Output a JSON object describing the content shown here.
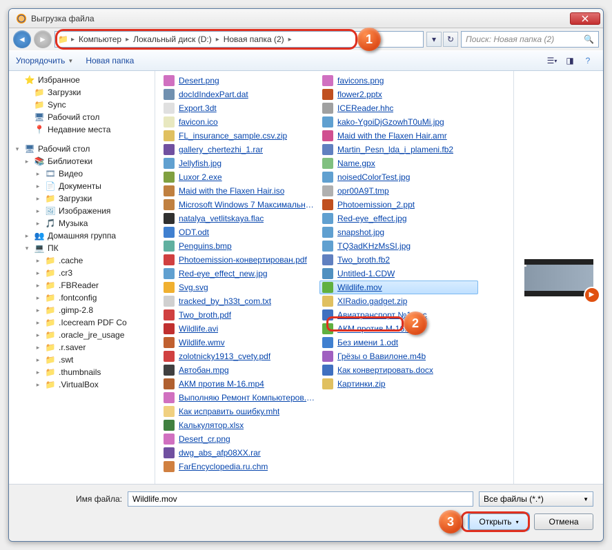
{
  "window": {
    "title": "Выгрузка файла"
  },
  "nav": {
    "crumbs": [
      "Компьютер",
      "Локальный диск (D:)",
      "Новая папка (2)"
    ],
    "search_placeholder": "Поиск: Новая папка (2)"
  },
  "toolbar": {
    "organize": "Упорядочить",
    "new_folder": "Новая папка"
  },
  "tree": [
    {
      "l": 1,
      "exp": "",
      "ic": "⭐",
      "t": "Избранное",
      "c": "#c8a030"
    },
    {
      "l": 2,
      "exp": "",
      "ic": "📁",
      "t": "Загрузки",
      "c": "#e0b050"
    },
    {
      "l": 2,
      "exp": "",
      "ic": "📁",
      "t": "Sync",
      "c": "#e0b050"
    },
    {
      "l": 2,
      "exp": "",
      "ic": "🖥",
      "t": "Рабочий стол",
      "c": "#4070a0"
    },
    {
      "l": 2,
      "exp": "",
      "ic": "📍",
      "t": "Недавние места",
      "c": "#8090a0"
    },
    {
      "l": 0,
      "gap": true
    },
    {
      "l": 1,
      "exp": "▾",
      "ic": "🖥",
      "t": "Рабочий стол",
      "c": "#4070a0"
    },
    {
      "l": 2,
      "exp": "▸",
      "ic": "📚",
      "t": "Библиотеки",
      "c": "#d0a040"
    },
    {
      "l": 3,
      "exp": "▸",
      "ic": "🎞",
      "t": "Видео",
      "c": "#6080a0"
    },
    {
      "l": 3,
      "exp": "▸",
      "ic": "📄",
      "t": "Документы",
      "c": "#8090a0"
    },
    {
      "l": 3,
      "exp": "▸",
      "ic": "📁",
      "t": "Загрузки",
      "c": "#e0b050"
    },
    {
      "l": 3,
      "exp": "▸",
      "ic": "🖼",
      "t": "Изображения",
      "c": "#60a0c0"
    },
    {
      "l": 3,
      "exp": "▸",
      "ic": "🎵",
      "t": "Музыка",
      "c": "#4080c0"
    },
    {
      "l": 2,
      "exp": "▸",
      "ic": "👥",
      "t": "Домашняя группа",
      "c": "#80a060"
    },
    {
      "l": 2,
      "exp": "▾",
      "ic": "💻",
      "t": "ПК",
      "c": "#6080a0"
    },
    {
      "l": 3,
      "exp": "▸",
      "ic": "📁",
      "t": ".cache",
      "c": "#e0b050"
    },
    {
      "l": 3,
      "exp": "▸",
      "ic": "📁",
      "t": ".cr3",
      "c": "#e0b050"
    },
    {
      "l": 3,
      "exp": "▸",
      "ic": "📁",
      "t": ".FBReader",
      "c": "#e0b050"
    },
    {
      "l": 3,
      "exp": "▸",
      "ic": "📁",
      "t": ".fontconfig",
      "c": "#e0b050"
    },
    {
      "l": 3,
      "exp": "▸",
      "ic": "📁",
      "t": ".gimp-2.8",
      "c": "#e0b050"
    },
    {
      "l": 3,
      "exp": "▸",
      "ic": "📁",
      "t": ".Icecream PDF Co",
      "c": "#e0b050"
    },
    {
      "l": 3,
      "exp": "▸",
      "ic": "📁",
      "t": ".oracle_jre_usage",
      "c": "#e0b050"
    },
    {
      "l": 3,
      "exp": "▸",
      "ic": "📁",
      "t": ".r.saver",
      "c": "#e0b050"
    },
    {
      "l": 3,
      "exp": "▸",
      "ic": "📁",
      "t": ".swt",
      "c": "#e0b050"
    },
    {
      "l": 3,
      "exp": "▸",
      "ic": "📁",
      "t": ".thumbnails",
      "c": "#e0b050"
    },
    {
      "l": 3,
      "exp": "▸",
      "ic": "📁",
      "t": ".VirtualBox",
      "c": "#e0b050"
    }
  ],
  "files_col1": [
    {
      "n": "Desert.png",
      "c": "c-png"
    },
    {
      "n": "docIdIndexPart.dat",
      "c": "c-dat"
    },
    {
      "n": "Export.3dt",
      "c": "c-3dt"
    },
    {
      "n": "favicon.ico",
      "c": "c-ico"
    },
    {
      "n": "FL_insurance_sample.csv.zip",
      "c": "c-zip"
    },
    {
      "n": "gallery_chertezhi_1.rar",
      "c": "c-rar"
    },
    {
      "n": "Jellyfish.jpg",
      "c": "c-jpg"
    },
    {
      "n": "Luxor 2.exe",
      "c": "c-exe"
    },
    {
      "n": "Maid with the Flaxen Hair.iso",
      "c": "c-iso"
    },
    {
      "n": "Microsoft Windows 7 Максимальна...",
      "c": "c-iso"
    },
    {
      "n": "natalya_vetlitskaya.flac",
      "c": "c-flac"
    },
    {
      "n": "ODT.odt",
      "c": "c-odt"
    },
    {
      "n": "Penguins.bmp",
      "c": "c-bmp"
    },
    {
      "n": "Photoemission-конвертирован.pdf",
      "c": "c-pdf"
    },
    {
      "n": "Red-eye_effect_new.jpg",
      "c": "c-jpg"
    },
    {
      "n": "Svg.svg",
      "c": "c-svg"
    },
    {
      "n": "tracked_by_h33t_com.txt",
      "c": "c-txt"
    },
    {
      "n": "Two_broth.pdf",
      "c": "c-pdf"
    },
    {
      "n": "Wildlife.avi",
      "c": "c-avi"
    },
    {
      "n": "Wildlife.wmv",
      "c": "c-wmv"
    },
    {
      "n": "zolotnicky1913_cvety.pdf",
      "c": "c-pdf"
    },
    {
      "n": "Автобан.mpg",
      "c": "c-mpg"
    },
    {
      "n": "АКМ против М-16.mp4",
      "c": "c-mp4"
    },
    {
      "n": "Выполняю Ремонт Компьютеров.png",
      "c": "c-png"
    },
    {
      "n": "Как исправить ошибку.mht",
      "c": "c-mht"
    },
    {
      "n": "Калькулятор.xlsx",
      "c": "c-xls"
    }
  ],
  "files_col2": [
    {
      "n": "Desert_cr.png",
      "c": "c-png"
    },
    {
      "n": "dwg_abs_afp08XX.rar",
      "c": "c-rar"
    },
    {
      "n": "FarEncyclopedia.ru.chm",
      "c": "c-chm"
    },
    {
      "n": "favicons.png",
      "c": "c-png"
    },
    {
      "n": "flower2.pptx",
      "c": "c-pptx"
    },
    {
      "n": "ICEReader.hhc",
      "c": "c-hhc"
    },
    {
      "n": "kako-YgoiDjGzowhT0uMi.jpg",
      "c": "c-jpg"
    },
    {
      "n": "Maid with the Flaxen Hair.amr",
      "c": "c-amr"
    },
    {
      "n": "Martin_Pesn_lda_i_plameni.fb2",
      "c": "c-fb2"
    },
    {
      "n": "Name.gpx",
      "c": "c-gpx"
    },
    {
      "n": "noisedColorTest.jpg",
      "c": "c-jpg"
    },
    {
      "n": "opr00A9T.tmp",
      "c": "c-tmp"
    },
    {
      "n": "Photoemission_2.ppt",
      "c": "c-ppt"
    },
    {
      "n": "Red-eye_effect.jpg",
      "c": "c-jpg"
    },
    {
      "n": "snapshot.jpg",
      "c": "c-jpg"
    },
    {
      "n": "TQ3adKHzMsSI.jpg",
      "c": "c-jpg"
    },
    {
      "n": "Two_broth.fb2",
      "c": "c-fb2"
    },
    {
      "n": "Untitled-1.CDW",
      "c": "c-cdw"
    },
    {
      "n": "Wildlife.mov",
      "c": "c-mov",
      "sel": true
    },
    {
      "n": "XIRadio.gadget.zip",
      "c": "c-zip"
    },
    {
      "n": "Авиатранспорт №1.doc",
      "c": "c-doc"
    },
    {
      "n": "АКМ против М-16.mov",
      "c": "c-mov"
    },
    {
      "n": "Без имени 1.odt",
      "c": "c-odt"
    },
    {
      "n": "Грёзы о Вавилоне.m4b",
      "c": "c-m4b"
    },
    {
      "n": "Как конвертировать.docx",
      "c": "c-docx"
    },
    {
      "n": "Картинки.zip",
      "c": "c-zip"
    }
  ],
  "footer": {
    "name_label": "Имя файла:",
    "name_value": "Wildlife.mov",
    "type_value": "Все файлы (*.*)",
    "open": "Открыть",
    "cancel": "Отмена"
  },
  "callouts": {
    "1": "1",
    "2": "2",
    "3": "3"
  }
}
